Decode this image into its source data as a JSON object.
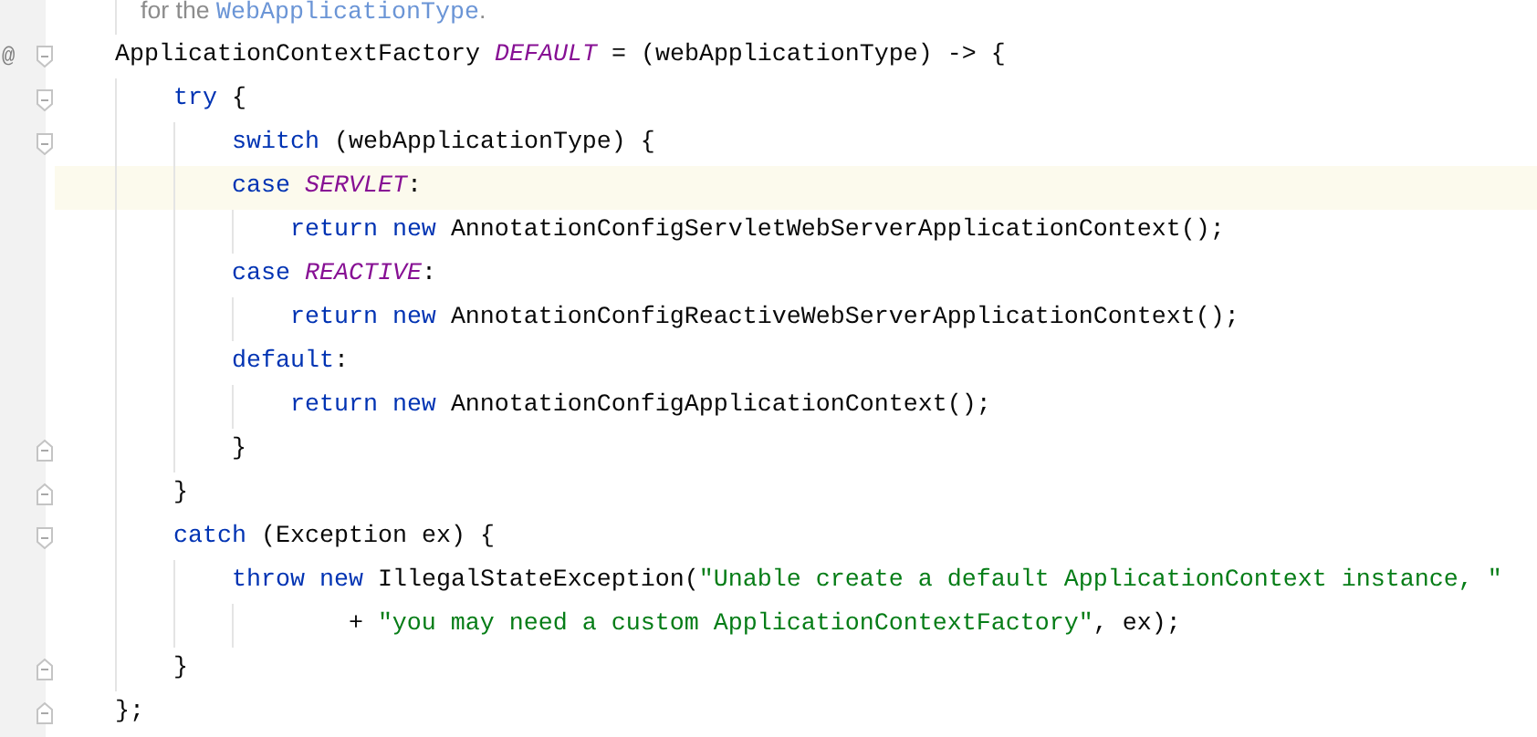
{
  "editor": {
    "lines": [
      {
        "kind": "doc",
        "current": false,
        "tokens": [
          {
            "kind": "doc",
            "text": "for the "
          },
          {
            "kind": "doc-link",
            "text": "WebApplicationType"
          },
          {
            "kind": "doc",
            "text": "."
          }
        ]
      },
      {
        "kind": "code",
        "current": false,
        "gutter_text": "@",
        "fold_start": true,
        "tokens": [
          {
            "kind": "plain",
            "text": "ApplicationContextFactory "
          },
          {
            "kind": "constant",
            "text": "DEFAULT"
          },
          {
            "kind": "plain",
            "text": " = (webApplicationType) -> {"
          }
        ]
      },
      {
        "kind": "code",
        "current": false,
        "fold_start": true,
        "tokens": [
          {
            "kind": "keyword",
            "text": "    try"
          },
          {
            "kind": "plain",
            "text": " {"
          }
        ]
      },
      {
        "kind": "code",
        "current": false,
        "fold_start": true,
        "tokens": [
          {
            "kind": "keyword",
            "text": "        switch"
          },
          {
            "kind": "plain",
            "text": " (webApplicationType) {"
          }
        ]
      },
      {
        "kind": "code",
        "current": true,
        "tokens": [
          {
            "kind": "keyword",
            "text": "        case "
          },
          {
            "kind": "constant",
            "text": "SERVLET"
          },
          {
            "kind": "plain",
            "text": ":"
          }
        ]
      },
      {
        "kind": "code",
        "current": false,
        "tokens": [
          {
            "kind": "keyword",
            "text": "            return new "
          },
          {
            "kind": "plain",
            "text": "AnnotationConfigServletWebServerApplicationContext();"
          }
        ]
      },
      {
        "kind": "code",
        "current": false,
        "tokens": [
          {
            "kind": "keyword",
            "text": "        case "
          },
          {
            "kind": "constant",
            "text": "REACTIVE"
          },
          {
            "kind": "plain",
            "text": ":"
          }
        ]
      },
      {
        "kind": "code",
        "current": false,
        "tokens": [
          {
            "kind": "keyword",
            "text": "            return new "
          },
          {
            "kind": "plain",
            "text": "AnnotationConfigReactiveWebServerApplicationContext();"
          }
        ]
      },
      {
        "kind": "code",
        "current": false,
        "tokens": [
          {
            "kind": "keyword",
            "text": "        default"
          },
          {
            "kind": "plain",
            "text": ":"
          }
        ]
      },
      {
        "kind": "code",
        "current": false,
        "tokens": [
          {
            "kind": "keyword",
            "text": "            return new "
          },
          {
            "kind": "plain",
            "text": "AnnotationConfigApplicationContext();"
          }
        ]
      },
      {
        "kind": "code",
        "current": false,
        "fold_end": true,
        "tokens": [
          {
            "kind": "plain",
            "text": "        }"
          }
        ]
      },
      {
        "kind": "code",
        "current": false,
        "fold_end": true,
        "tokens": [
          {
            "kind": "plain",
            "text": "    }"
          }
        ]
      },
      {
        "kind": "code",
        "current": false,
        "fold_start": true,
        "tokens": [
          {
            "kind": "keyword",
            "text": "    catch"
          },
          {
            "kind": "plain",
            "text": " (Exception ex) {"
          }
        ]
      },
      {
        "kind": "code",
        "current": false,
        "tokens": [
          {
            "kind": "keyword",
            "text": "        throw new "
          },
          {
            "kind": "plain",
            "text": "IllegalStateException("
          },
          {
            "kind": "string",
            "text": "\"Unable create a default ApplicationContext instance, \""
          }
        ]
      },
      {
        "kind": "code",
        "current": false,
        "tokens": [
          {
            "kind": "plain",
            "text": "                + "
          },
          {
            "kind": "string",
            "text": "\"you may need a custom ApplicationContextFactory\""
          },
          {
            "kind": "plain",
            "text": ", ex);"
          }
        ]
      },
      {
        "kind": "code",
        "current": false,
        "fold_end": true,
        "tokens": [
          {
            "kind": "plain",
            "text": "    }"
          }
        ]
      },
      {
        "kind": "code",
        "current": false,
        "fold_end": true,
        "tokens": [
          {
            "kind": "plain",
            "text": "};"
          }
        ]
      }
    ]
  }
}
